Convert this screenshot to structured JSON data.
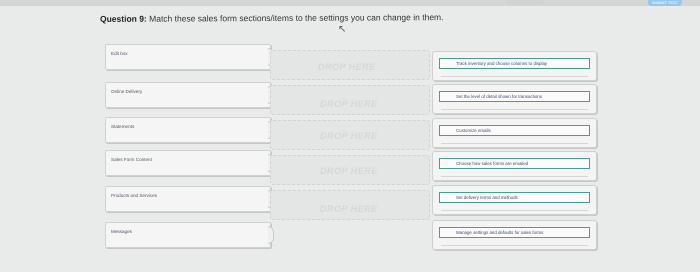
{
  "header": {
    "progress_tab_label": "",
    "submit_label": "SUBMIT TEST"
  },
  "question": {
    "number": "Question 9:",
    "text": "Match these sales form sections/items to the settings you can change in them."
  },
  "left_items": [
    {
      "label": "Edit box"
    },
    {
      "label": "Online Delivery"
    },
    {
      "label": "Statements"
    },
    {
      "label": "Sales Form Content"
    },
    {
      "label": "Products and Services"
    },
    {
      "label": "Messages"
    }
  ],
  "drop_zones": [
    {
      "label": "DROP HERE"
    },
    {
      "label": "DROP HERE"
    },
    {
      "label": "DROP HERE"
    },
    {
      "label": "DROP HERE"
    },
    {
      "label": "DROP HERE"
    }
  ],
  "right_items": [
    {
      "label": "Track inventory and choose columns to display"
    },
    {
      "label": "Set the level of detail shown for transactions"
    },
    {
      "label": "Customize emails"
    },
    {
      "label": "Choose how sales forms are emailed"
    },
    {
      "label": "Set delivery terms and methods"
    },
    {
      "label": "Manage settings and defaults for sales forms"
    }
  ]
}
